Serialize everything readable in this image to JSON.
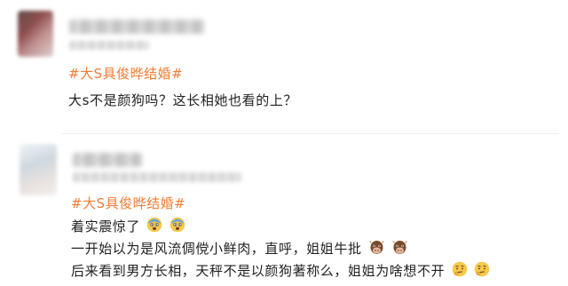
{
  "comments": [
    {
      "hashtag": "#大S具俊晔结婚#",
      "lines": [
        "大s不是颜狗吗？这长相她也看的上？"
      ]
    },
    {
      "hashtag": "#大S具俊晔结婚#",
      "lines": [
        "着实震惊了",
        "一开始以为是风流倜傥小鲜肉，直呼，姐姐牛批",
        "后来看到男方长相，天秤不是以颜狗著称么，姐姐为啥想不开"
      ],
      "emojis": {
        "line1": [
          "fearful-face-icon",
          "fearful-face-icon"
        ],
        "line2": [
          "cow-face-icon",
          "cow-face-icon"
        ],
        "line3": [
          "thinking-face-icon",
          "thinking-face-icon"
        ]
      }
    }
  ],
  "colors": {
    "hashtag": "#f27c35",
    "text": "#1f1f1f",
    "background": "#ffffff"
  }
}
